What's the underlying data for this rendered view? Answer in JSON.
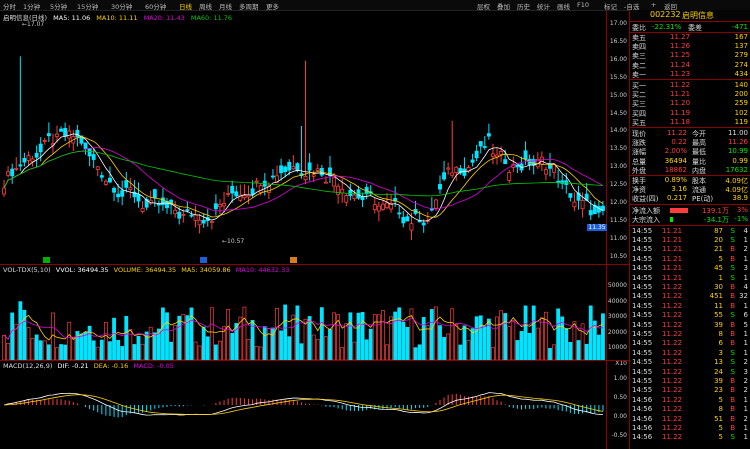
{
  "menu": {
    "left": [
      "分时",
      "1分钟",
      "5分钟",
      "15分钟",
      "30分钟",
      "60分钟",
      "日线",
      "周线",
      "月线",
      "多周期",
      "更多"
    ],
    "active": "日线",
    "right": [
      "层权",
      "叠加",
      "历史",
      "统计",
      "画线",
      "F10",
      "标记",
      "-自选",
      "+",
      "返回"
    ]
  },
  "stock": {
    "code": "002232",
    "name": "启明信息"
  },
  "main_legend": {
    "title": "启明信息(日线)",
    "ma5": "MA5: 11.06",
    "ma10": "MA10: 11.11",
    "ma20": "MA20: 11.43",
    "ma60": "MA60: 11.76"
  },
  "annotations": {
    "high": "17.07",
    "low": "10.57",
    "m1": "高",
    "m2": "低",
    "m3": "振"
  },
  "price_axis": [
    "17.00",
    "16.50",
    "16.00",
    "15.50",
    "15.00",
    "14.50",
    "14.00",
    "13.50",
    "13.00",
    "12.50",
    "12.00",
    "11.50",
    "11.00",
    "10.50"
  ],
  "current_price_tag": "11.35",
  "vol_legend": {
    "title": "VOL-TDX(5,10)",
    "vvol": "VVOL: 36494.35",
    "volume": "VOLUME: 36494.35",
    "ma5": "MA5: 34059.86",
    "ma10": "MA10: 44632.33"
  },
  "vol_axis": [
    "50000",
    "40000",
    "30000",
    "20000",
    "10000",
    "X10"
  ],
  "macd_legend": {
    "title": "MACD(12,26,9)",
    "dif": "DIF: -0.21",
    "dea": "DEA: -0.16",
    "macd": "MACD: -0.05"
  },
  "macd_axis": [
    "1.00",
    "0.50",
    "0.00",
    "-0.50"
  ],
  "quote": {
    "webi_label": "委比",
    "webi": "-22.31%",
    "wecha_label": "委差",
    "wecha": "-471",
    "asks": [
      {
        "label": "卖五",
        "price": "11.27",
        "vol": "167"
      },
      {
        "label": "卖四",
        "price": "11.26",
        "vol": "137"
      },
      {
        "label": "卖三",
        "price": "11.25",
        "vol": "279"
      },
      {
        "label": "卖二",
        "price": "11.24",
        "vol": "274"
      },
      {
        "label": "卖一",
        "price": "11.23",
        "vol": "434"
      }
    ],
    "bids": [
      {
        "label": "买一",
        "price": "11.22",
        "vol": "140"
      },
      {
        "label": "买二",
        "price": "11.21",
        "vol": "200"
      },
      {
        "label": "买三",
        "price": "11.20",
        "vol": "259"
      },
      {
        "label": "买四",
        "price": "11.19",
        "vol": "102"
      },
      {
        "label": "买五",
        "price": "11.18",
        "vol": "119"
      }
    ],
    "stats": [
      {
        "l1": "现价",
        "v1": "11.22",
        "c1": "red",
        "l2": "今开",
        "v2": "11.00",
        "c2": "white"
      },
      {
        "l1": "涨跌",
        "v1": "0.22",
        "c1": "red",
        "l2": "最高",
        "v2": "11.26",
        "c2": "red"
      },
      {
        "l1": "涨幅",
        "v1": "2.00%",
        "c1": "red",
        "l2": "最低",
        "v2": "10.99",
        "c2": "green"
      },
      {
        "l1": "总量",
        "v1": "36494",
        "c1": "yel",
        "l2": "量比",
        "v2": "0.99",
        "c2": "yel"
      },
      {
        "l1": "外盘",
        "v1": "18862",
        "c1": "red",
        "l2": "内盘",
        "v2": "17632",
        "c2": "green"
      },
      {
        "l1": "换手",
        "v1": "0.89%",
        "c1": "yel",
        "l2": "股本",
        "v2": "4.09亿",
        "c2": "yel"
      },
      {
        "l1": "净资",
        "v1": "3.16",
        "c1": "yel",
        "l2": "流通",
        "v2": "4.09亿",
        "c2": "yel"
      },
      {
        "l1": "收益(四)",
        "v1": "0.217",
        "c1": "yel",
        "l2": "PE(动)",
        "v2": "38.9",
        "c2": "yel"
      }
    ],
    "flow": [
      {
        "label": "净流入额",
        "val": "139.1万",
        "pct": "3%",
        "color": "red",
        "bar": 0.9
      },
      {
        "label": "大宗流入",
        "val": "-34.1万",
        "pct": "-1%",
        "color": "green",
        "bar": 0.15
      }
    ],
    "ticks": [
      {
        "t": "14:55",
        "p": "11.21",
        "v": "87",
        "d": "S",
        "n": "4"
      },
      {
        "t": "14:55",
        "p": "11.21",
        "v": "20",
        "d": "S",
        "n": "1"
      },
      {
        "t": "14:55",
        "p": "11.21",
        "v": "21",
        "d": "B",
        "n": "2"
      },
      {
        "t": "14:55",
        "p": "11.21",
        "v": "5",
        "d": "B",
        "n": "1"
      },
      {
        "t": "14:55",
        "p": "11.21",
        "v": "45",
        "d": "S",
        "n": "3"
      },
      {
        "t": "14:55",
        "p": "11.21",
        "v": "1",
        "d": "S",
        "n": "1"
      },
      {
        "t": "14:55",
        "p": "11.22",
        "v": "30",
        "d": "B",
        "n": "4"
      },
      {
        "t": "14:55",
        "p": "11.22",
        "v": "451",
        "d": "B",
        "n": "32"
      },
      {
        "t": "14:55",
        "p": "11.22",
        "v": "11",
        "d": "B",
        "n": "1"
      },
      {
        "t": "14:55",
        "p": "11.22",
        "v": "55",
        "d": "S",
        "n": "6"
      },
      {
        "t": "14:55",
        "p": "11.22",
        "v": "39",
        "d": "B",
        "n": "5"
      },
      {
        "t": "14:55",
        "p": "11.22",
        "v": "8",
        "d": "B",
        "n": "1"
      },
      {
        "t": "14:55",
        "p": "11.22",
        "v": "6",
        "d": "B",
        "n": "1"
      },
      {
        "t": "14:55",
        "p": "11.22",
        "v": "3",
        "d": "S",
        "n": "1"
      },
      {
        "t": "14:55",
        "p": "11.22",
        "v": "13",
        "d": "S",
        "n": "2"
      },
      {
        "t": "14:55",
        "p": "11.22",
        "v": "24",
        "d": "S",
        "n": "3"
      },
      {
        "t": "14:55",
        "p": "11.22",
        "v": "39",
        "d": "B",
        "n": "2"
      },
      {
        "t": "14:55",
        "p": "11.22",
        "v": "23",
        "d": "B",
        "n": "2"
      },
      {
        "t": "14:56",
        "p": "11.22",
        "v": "5",
        "d": "B",
        "n": "1"
      },
      {
        "t": "14:56",
        "p": "11.22",
        "v": "8",
        "d": "B",
        "n": "1"
      },
      {
        "t": "14:56",
        "p": "11.22",
        "v": "51",
        "d": "B",
        "n": "2"
      },
      {
        "t": "14:56",
        "p": "11.22",
        "v": "5",
        "d": "B",
        "n": "1"
      },
      {
        "t": "14:56",
        "p": "11.22",
        "v": "5",
        "d": "S",
        "n": "1"
      },
      {
        "t": "14:56",
        "p": "11.22",
        "v": "10",
        "d": "S",
        "n": "1"
      },
      {
        "t": "14:56",
        "p": "11.22",
        "v": "5",
        "d": "B",
        "n": "1"
      }
    ]
  },
  "colors": {
    "up": "#ff3c3c",
    "down": "#00e5ff",
    "ma5": "#ffffff",
    "ma10": "#ffd200",
    "ma20": "#e000e0",
    "ma60": "#00c800",
    "border": "#8b0000"
  }
}
